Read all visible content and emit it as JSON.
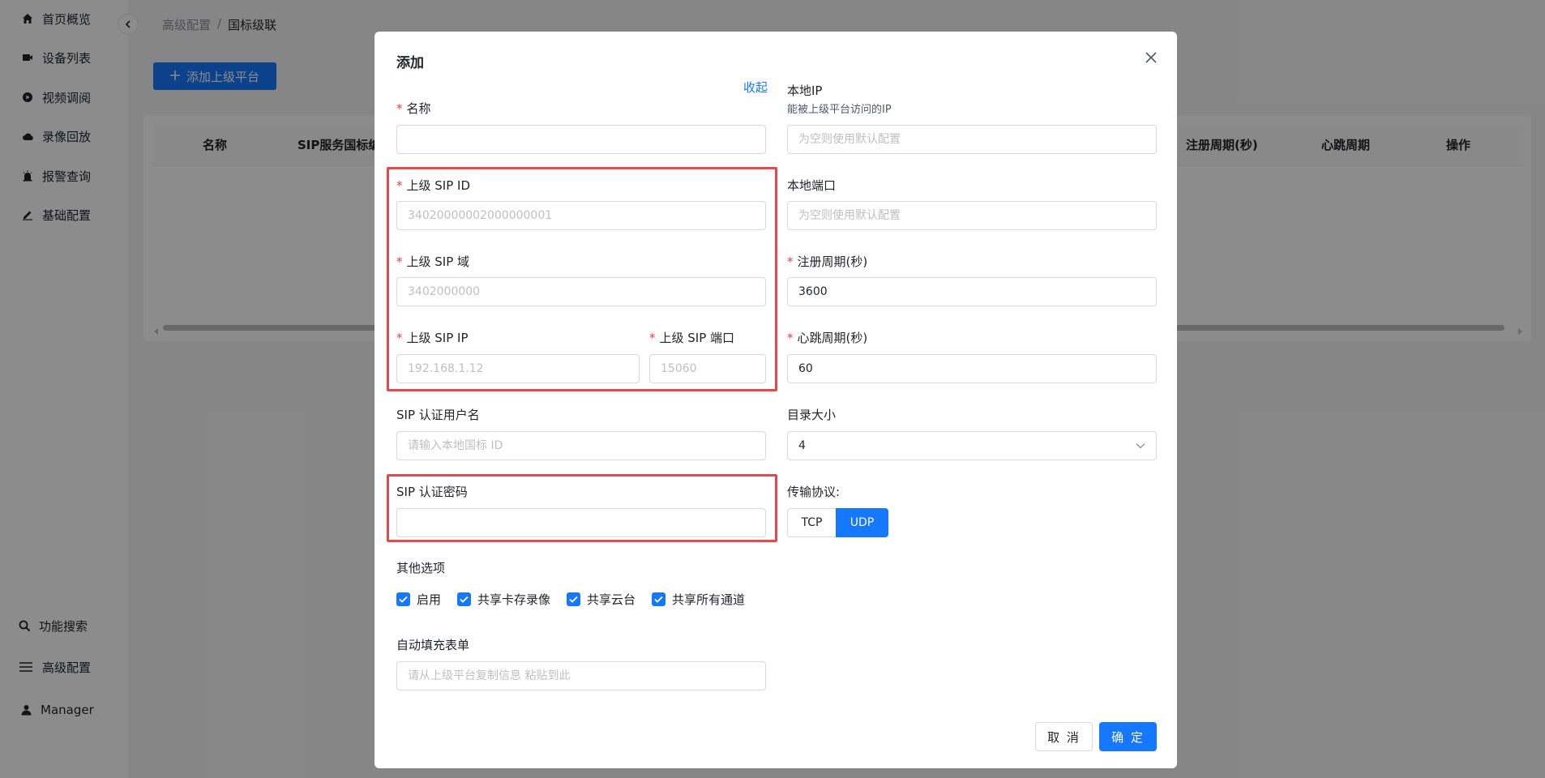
{
  "sidebar": {
    "items": [
      {
        "label": "首页概览",
        "icon": "home-icon"
      },
      {
        "label": "设备列表",
        "icon": "device-icon"
      },
      {
        "label": "视频调阅",
        "icon": "play-icon"
      },
      {
        "label": "录像回放",
        "icon": "cloud-icon"
      },
      {
        "label": "报警查询",
        "icon": "alarm-icon"
      },
      {
        "label": "基础配置",
        "icon": "edit-icon"
      }
    ],
    "bottom": [
      {
        "label": "功能搜索",
        "icon": "search-icon"
      },
      {
        "label": "高级配置",
        "icon": "menu-icon"
      },
      {
        "label": "Manager",
        "icon": "user-icon"
      }
    ]
  },
  "breadcrumb": {
    "parent": "高级配置",
    "separator": "/",
    "current": "国标级联"
  },
  "toolbar": {
    "add_label": "添加上级平台"
  },
  "table": {
    "columns": [
      "名称",
      "SIP服务国标编",
      "注册周期(秒)",
      "心跳周期",
      "操作"
    ]
  },
  "modal": {
    "title": "添加",
    "collapse_label": "收起",
    "fields": {
      "name": {
        "label": "名称",
        "value": "",
        "placeholder": ""
      },
      "sip_id": {
        "label": "上级 SIP ID",
        "value": "",
        "placeholder": "34020000002000000001"
      },
      "sip_domain": {
        "label": "上级 SIP 域",
        "value": "",
        "placeholder": "3402000000"
      },
      "sip_ip": {
        "label": "上级 SIP IP",
        "value": "",
        "placeholder": "192.168.1.12"
      },
      "sip_port": {
        "label": "上级 SIP 端口",
        "value": "",
        "placeholder": "15060"
      },
      "auth_user": {
        "label": "SIP 认证用户名",
        "value": "",
        "placeholder": "请输入本地国标 ID"
      },
      "auth_pass": {
        "label": "SIP 认证密码",
        "value": "",
        "placeholder": ""
      },
      "local_ip": {
        "label": "本地IP",
        "hint": "能被上级平台访问的IP",
        "value": "",
        "placeholder": "为空则使用默认配置"
      },
      "local_port": {
        "label": "本地端口",
        "value": "",
        "placeholder": "为空则使用默认配置"
      },
      "register_period": {
        "label": "注册周期(秒)",
        "value": "3600",
        "placeholder": ""
      },
      "heartbeat_period": {
        "label": "心跳周期(秒)",
        "value": "60",
        "placeholder": ""
      },
      "catalog_size": {
        "label": "目录大小",
        "value": "4"
      },
      "transport": {
        "label": "传输协议:",
        "options": [
          "TCP",
          "UDP"
        ],
        "selected": "UDP"
      },
      "autofill": {
        "label": "自动填充表单",
        "value": "",
        "placeholder": "请从上级平台复制信息 粘贴到此"
      }
    },
    "other_options": {
      "label": "其他选项",
      "items": [
        {
          "label": "启用",
          "checked": true
        },
        {
          "label": "共享卡存录像",
          "checked": true
        },
        {
          "label": "共享云台",
          "checked": true
        },
        {
          "label": "共享所有通道",
          "checked": true
        }
      ]
    },
    "cancel_label": "取 消",
    "ok_label": "确 定"
  },
  "colors": {
    "primary": "#1677ff",
    "highlight": "#e5484d",
    "required": "#f53f3f"
  }
}
